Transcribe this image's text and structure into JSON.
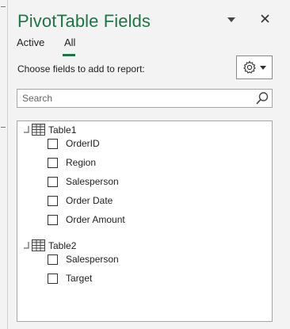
{
  "pane": {
    "title": "PivotTable Fields",
    "menu_icon": "chevron-down-icon",
    "close_icon": "close-icon"
  },
  "tabs": [
    {
      "label": "Active",
      "selected": false
    },
    {
      "label": "All",
      "selected": true
    }
  ],
  "choose_label": "Choose fields to add to report:",
  "tools_button": {
    "icon": "gear-icon",
    "dropdown_icon": "caret-down-icon"
  },
  "search": {
    "placeholder": "Search",
    "value": ""
  },
  "tables": [
    {
      "name": "Table1",
      "fields": [
        {
          "label": "OrderID",
          "checked": false
        },
        {
          "label": "Region",
          "checked": false
        },
        {
          "label": "Salesperson",
          "checked": false
        },
        {
          "label": "Order Date",
          "checked": false
        },
        {
          "label": "Order Amount",
          "checked": false
        }
      ]
    },
    {
      "name": "Table2",
      "fields": [
        {
          "label": "Salesperson",
          "checked": false
        },
        {
          "label": "Target",
          "checked": false
        }
      ]
    }
  ],
  "colors": {
    "accent": "#217346",
    "background": "#f3f3f3"
  }
}
